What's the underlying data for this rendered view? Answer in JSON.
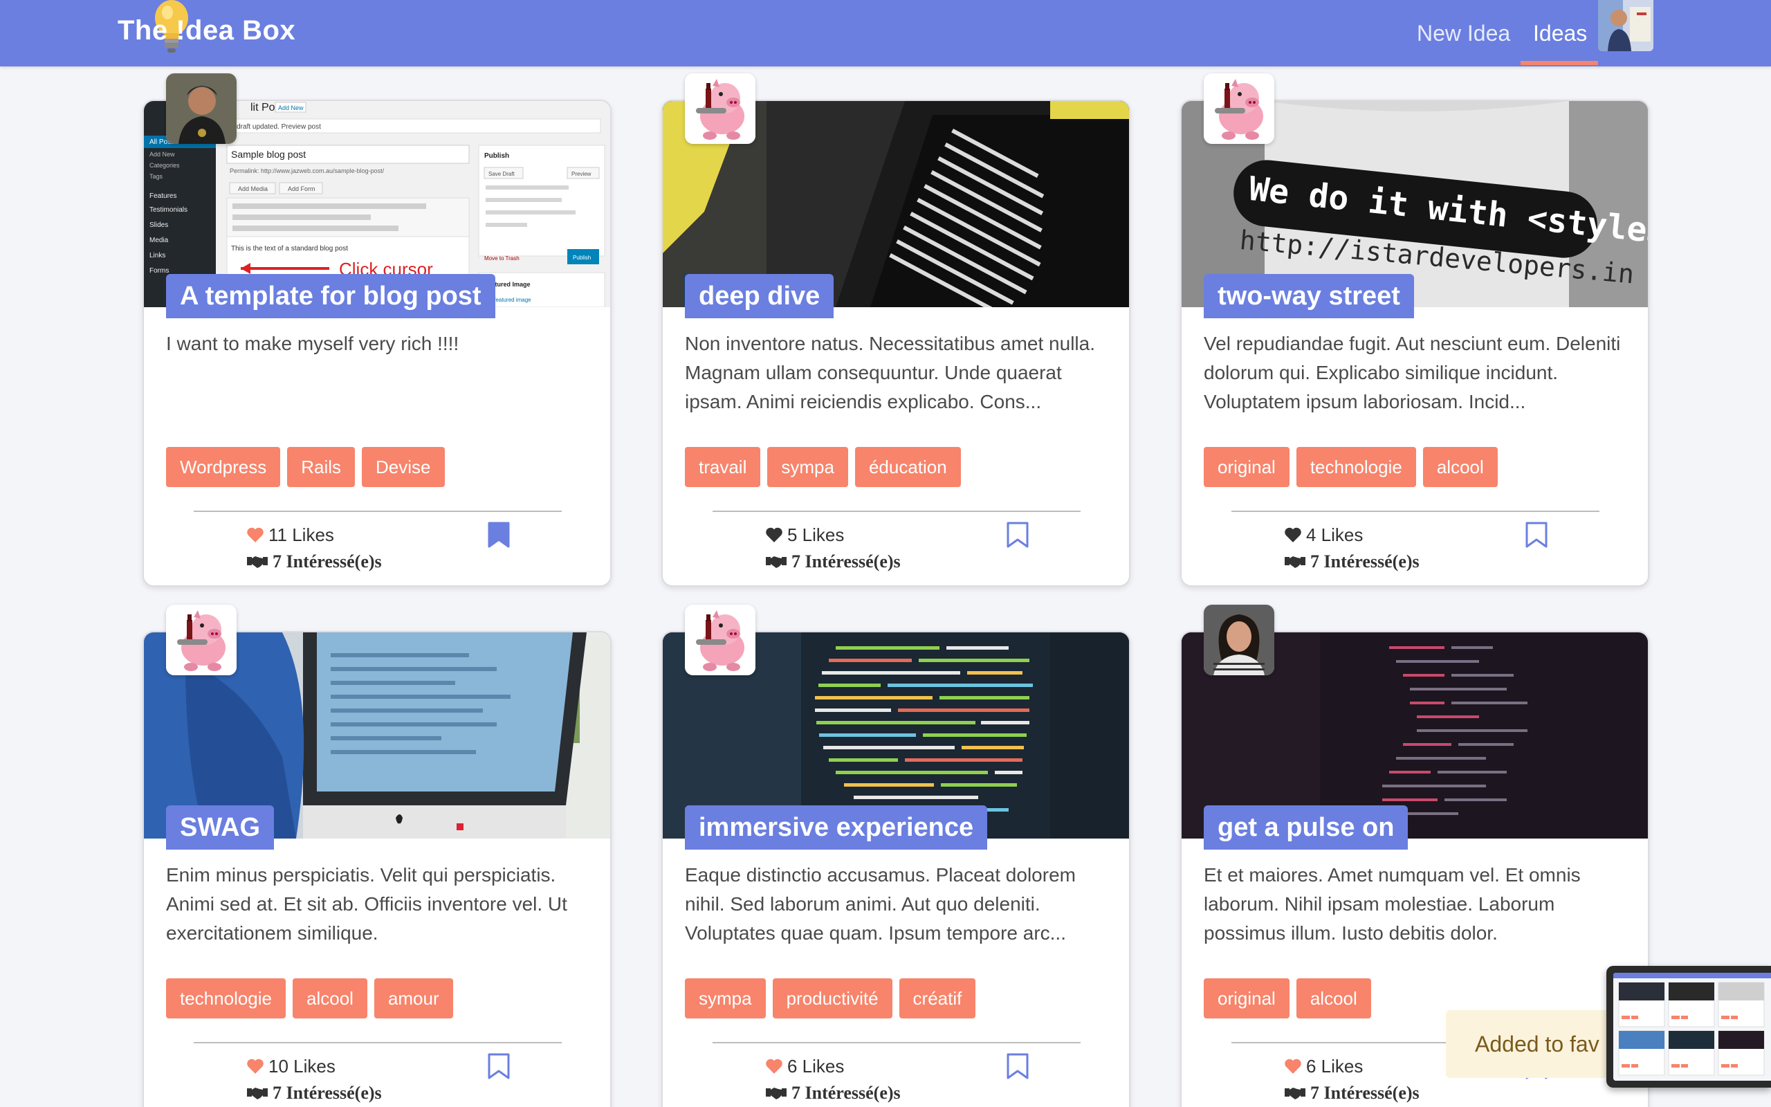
{
  "navbar": {
    "brand": "The !dea Box",
    "links": [
      {
        "label": "New Idea"
      },
      {
        "label": "Ideas"
      }
    ],
    "active": "Ideas"
  },
  "ideas": [
    {
      "title": "A template for blog post",
      "description": "I want to make myself very rich !!!!",
      "tags": [
        "Wordpress",
        "Rails",
        "Devise"
      ],
      "likes": "11 Likes",
      "liked": true,
      "interested": "7 Intéressé(e)s",
      "bookmarked": true,
      "image_text": {
        "header": "lit Post",
        "add_new": "Add New",
        "draft_notice": "ost draft updated. Preview post",
        "post_title": "Sample blog post",
        "permalink": "Permalink: http://www.jazweb.com.au/sample-blog-post/",
        "add_media": "Add Media",
        "add_form": "Add Form",
        "body_text": "This is the text of a standard blog post",
        "click_cursor": "Click cursor",
        "publish": "Publish",
        "save_draft": "Save Draft",
        "preview": "Preview",
        "move_trash": "Move to Trash",
        "publish_btn": "Publish",
        "featured_image": "Featured Image",
        "set_featured": "Set featured image",
        "menu": [
          "All Posts",
          "Add New",
          "Categories",
          "Tags",
          "Features",
          "Testimonials",
          "Slides",
          "Media",
          "Links",
          "Forms"
        ]
      }
    },
    {
      "title": "deep dive",
      "description": "Non inventore natus. Necessitatibus amet nulla. Magnam ullam consequuntur. Unde quaerat ipsam. Animi reiciendis explicabo. Cons...",
      "tags": [
        "travail",
        "sympa",
        "éducation"
      ],
      "likes": "5 Likes",
      "liked": false,
      "interested": "7 Intéressé(e)s",
      "bookmarked": false
    },
    {
      "title": "two-way street",
      "description": "Vel repudiandae fugit. Aut nesciunt eum. Deleniti dolorum qui. Explicabo similique incidunt. Voluptatem ipsum laboriosam. Incid...",
      "tags": [
        "original",
        "technologie",
        "alcool"
      ],
      "likes": "4 Likes",
      "liked": false,
      "interested": "7 Intéressé(e)s",
      "bookmarked": false,
      "image_text": {
        "shirt_line1": "We do it with <style>",
        "shirt_line2": "http://istardevelopers.in"
      }
    },
    {
      "title": "SWAG",
      "description": "Enim minus perspiciatis. Velit qui perspiciatis. Animi sed at. Et sit ab. Officiis inventore vel. Ut exercitationem similique.",
      "tags": [
        "technologie",
        "alcool",
        "amour"
      ],
      "likes": "10 Likes",
      "liked": true,
      "interested": "7 Intéressé(e)s",
      "bookmarked": false
    },
    {
      "title": "immersive experience",
      "description": "Eaque distinctio accusamus. Placeat dolorem nihil. Sed laborum animi. Aut quo deleniti. Voluptates quae quam. Ipsum tempore arc...",
      "tags": [
        "sympa",
        "productivité",
        "créatif"
      ],
      "likes": "6 Likes",
      "liked": true,
      "interested": "7 Intéressé(e)s",
      "bookmarked": false
    },
    {
      "title": "get a pulse on",
      "description": "Et et maiores. Amet numquam vel. Et omnis laborum. Nihil ipsam molestiae. Laborum possimus illum. Iusto debitis dolor.",
      "tags": [
        "original",
        "alcool"
      ],
      "likes": "6 Likes",
      "liked": true,
      "interested": "7 Intéressé(e)s",
      "bookmarked": false
    }
  ],
  "toast": {
    "text": "Added to fav"
  },
  "colors": {
    "navbar": "#6a7fe0",
    "title_badge": "#6a7fe0",
    "tag": "#f7846b",
    "active_underline": "#f7846b",
    "bookmark": "#6a7fe0",
    "heart_liked": "#f7846b",
    "heart_unliked": "#333333"
  },
  "icons": {
    "like": "heart-icon",
    "interested": "handshake-icon",
    "bookmark": "bookmark-icon",
    "brand": "lightbulb-icon"
  }
}
